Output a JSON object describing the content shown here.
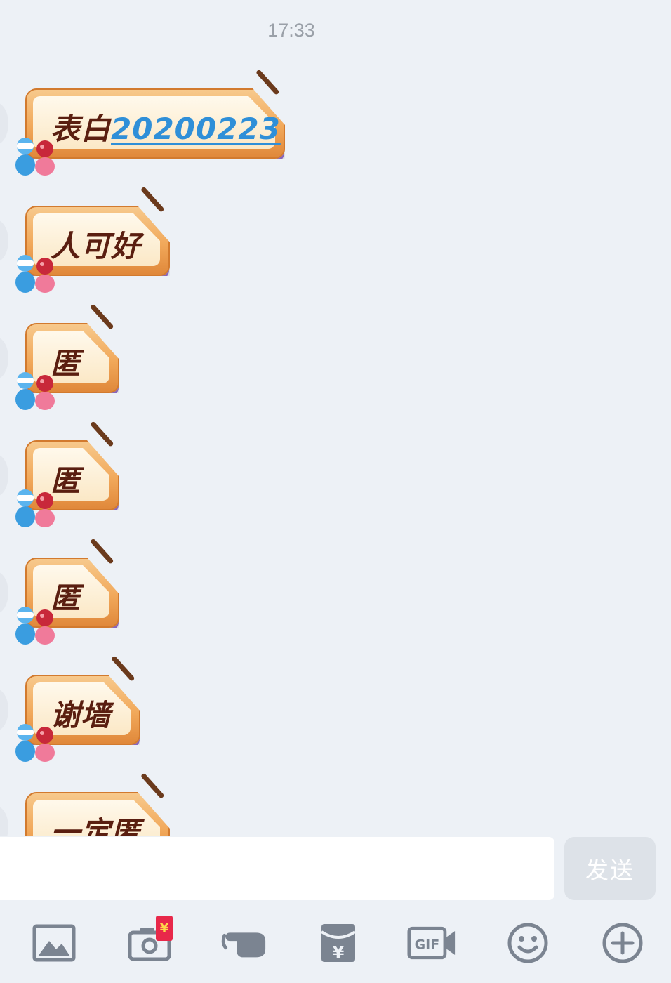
{
  "chat": {
    "timestamp": "17:33",
    "messages": [
      {
        "prefix": "表白",
        "number": "20200223"
      },
      {
        "prefix": "人可好",
        "number": ""
      },
      {
        "prefix": "匿",
        "number": ""
      },
      {
        "prefix": "匿",
        "number": ""
      },
      {
        "prefix": "匿",
        "number": ""
      },
      {
        "prefix": "谢墙",
        "number": ""
      },
      {
        "prefix": "一定匿",
        "number": ""
      }
    ]
  },
  "input": {
    "value": "",
    "placeholder": ""
  },
  "send_button": {
    "label": "发送"
  },
  "toolbar": {
    "items": [
      {
        "icon": "image-icon"
      },
      {
        "icon": "camera-icon",
        "badge": "¥"
      },
      {
        "icon": "poke-icon"
      },
      {
        "icon": "red-packet-icon",
        "glyph": "¥"
      },
      {
        "icon": "gif-icon",
        "glyph": "GIF"
      },
      {
        "icon": "emoji-icon"
      },
      {
        "icon": "plus-icon"
      }
    ]
  },
  "colors": {
    "background": "#edf1f6",
    "bubble_orange": "#f1a85a",
    "bubble_text": "#5a1e10",
    "link_blue": "#2f8fd8",
    "icon_gray": "#7b8491",
    "badge_red": "#e8284a"
  }
}
